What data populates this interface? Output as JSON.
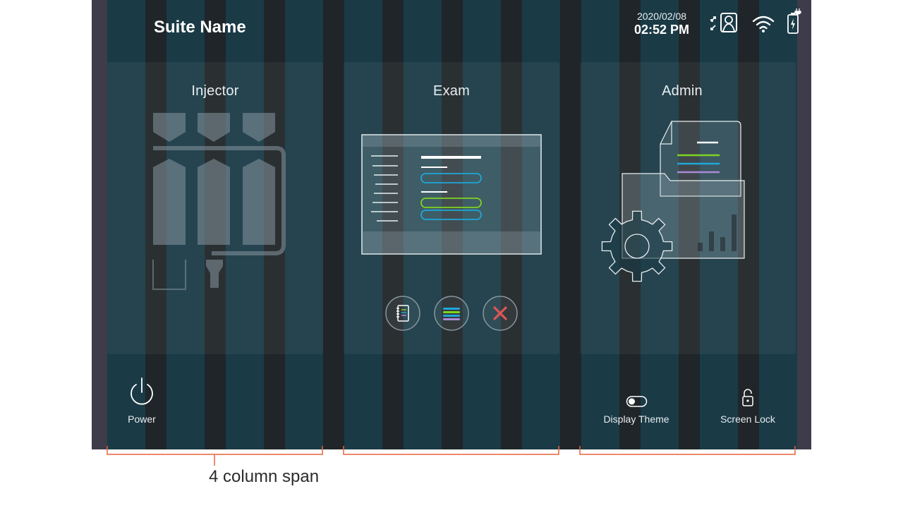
{
  "header": {
    "suite_name": "Suite Name",
    "date": "2020/02/08",
    "time": "02:52 PM",
    "status_icons": [
      "patient-link-icon",
      "wifi-icon",
      "battery-charging-icon"
    ]
  },
  "cards": {
    "injector": {
      "title": "Injector",
      "icon": "injector-syringes-icon"
    },
    "exam": {
      "title": "Exam",
      "icon": "exam-screen-icon",
      "actions": [
        {
          "icon": "notebook-icon"
        },
        {
          "icon": "protocol-list-icon"
        },
        {
          "icon": "close-x-icon"
        }
      ]
    },
    "admin": {
      "title": "Admin",
      "icon": "admin-settings-icon"
    }
  },
  "footer": {
    "power_label": "Power",
    "display_theme_label": "Display Theme",
    "screen_lock_label": "Screen Lock"
  },
  "annotation": {
    "caption": "4 column span"
  },
  "colors": {
    "screen_background": "#3e3b4b",
    "column_teal": "#1a3a46",
    "gutter_dark": "#1f2528",
    "annotation_orange": "#e8643a",
    "accent_green": "#7ed321",
    "accent_blue": "#1ea7d8",
    "accent_purple": "#a98bd6",
    "close_red": "#e05555"
  }
}
